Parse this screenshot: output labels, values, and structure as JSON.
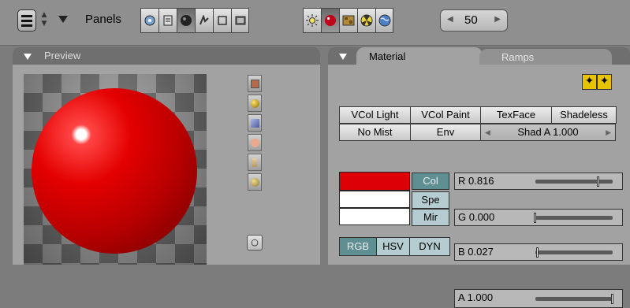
{
  "header": {
    "panels_label": "Panels",
    "frame_value": "50",
    "context_icons": [
      "logic-icon",
      "script-icon",
      "shading-icon",
      "object-icon",
      "editing-icon",
      "scene-icon"
    ],
    "shading_icons": [
      "lamp-icon",
      "material-icon",
      "texture-icon",
      "radiosity-icon",
      "world-icon"
    ]
  },
  "preview": {
    "title": "Preview",
    "material_color": "#e40000",
    "shape_buttons": [
      "plane-icon",
      "sphere-icon",
      "cube-icon",
      "monkey-icon",
      "hair-icon",
      "sky-icon"
    ]
  },
  "material": {
    "tabs": {
      "active": "Material",
      "inactive": "Ramps"
    },
    "toggles_row1": [
      "VCol Light",
      "VCol Paint",
      "TexFace",
      "Shadeless"
    ],
    "toggles_row2": [
      "No Mist",
      "Env"
    ],
    "shad_alpha": "Shad A 1.000",
    "colors": {
      "col": "#dd0007",
      "spe": "#ffffff",
      "mir": "#ffffff"
    },
    "channels": [
      "Col",
      "Spe",
      "Mir"
    ],
    "sliders": [
      {
        "label": "R 0.816",
        "value": 0.816
      },
      {
        "label": "G 0.000",
        "value": 0.0
      },
      {
        "label": "B 0.027",
        "value": 0.027
      }
    ],
    "color_modes": [
      "RGB",
      "HSV",
      "DYN"
    ],
    "alpha": {
      "label": "A 1.000",
      "value": 1.0
    }
  }
}
